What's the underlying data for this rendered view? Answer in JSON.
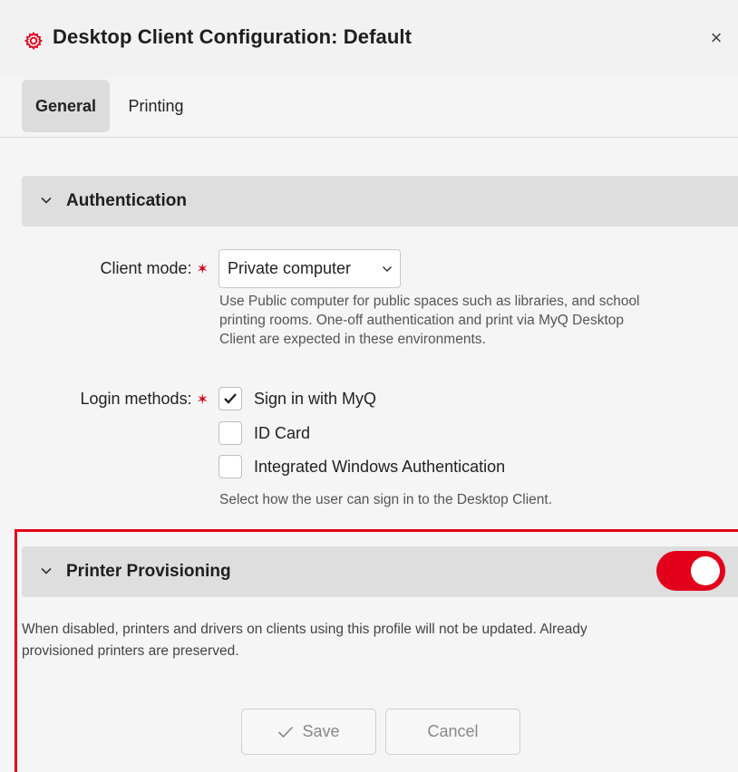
{
  "header": {
    "title": "Desktop Client Configuration: Default",
    "close_glyph": "×",
    "icon": "gear-icon",
    "accent_color": "#e3001b"
  },
  "tabs": [
    {
      "label": "General",
      "active": true
    },
    {
      "label": "Printing",
      "active": false
    }
  ],
  "authentication": {
    "title": "Authentication",
    "client_mode": {
      "label": "Client mode:",
      "required": "✶",
      "value": "Private computer",
      "help": [
        "Use Public computer for public spaces such as libraries, and school",
        "printing rooms. One-off authentication and print via MyQ Desktop",
        "Client are expected in these environments."
      ]
    },
    "login_methods": {
      "label": "Login methods:",
      "required": "✶",
      "options": [
        {
          "label": "Sign in with MyQ",
          "checked": true
        },
        {
          "label": "ID Card",
          "checked": false
        },
        {
          "label": "Integrated Windows Authentication",
          "checked": false
        }
      ],
      "help": "Select how the user can sign in to the Desktop Client."
    }
  },
  "printer_provisioning": {
    "title": "Printer Provisioning",
    "enabled": true,
    "description": [
      "When disabled, printers and drivers on clients using this profile will not be updated. Already",
      "provisioned printers are preserved."
    ]
  },
  "footer": {
    "save_label": "Save",
    "cancel_label": "Cancel"
  }
}
